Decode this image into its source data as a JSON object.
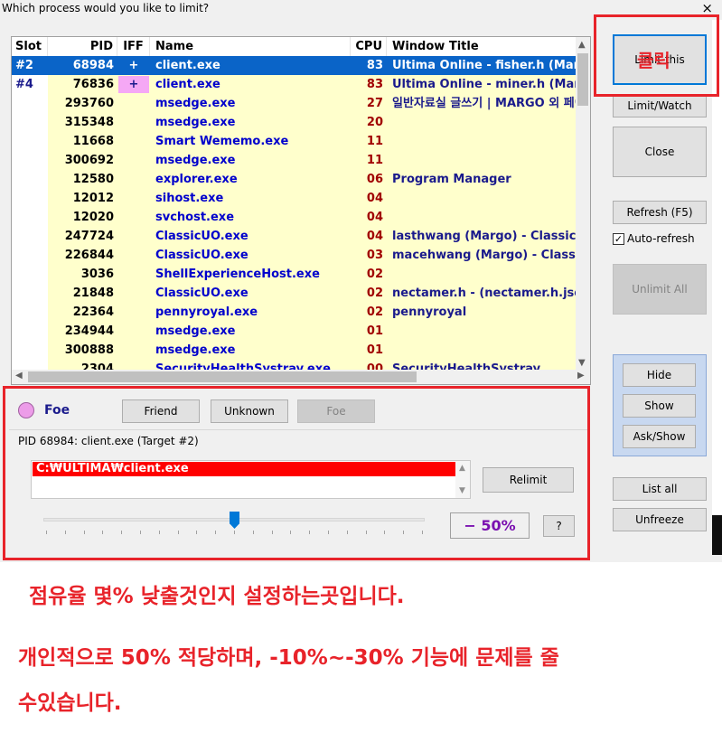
{
  "window": {
    "title": "Which process would you like to limit?",
    "close_glyph": "×"
  },
  "table": {
    "headers": {
      "slot": "Slot",
      "pid": "PID",
      "iff": "IFF",
      "name": "Name",
      "cpu": "CPU",
      "window_title": "Window Title"
    },
    "rows": [
      {
        "slot": "#2",
        "pid": "68984",
        "iff": "+",
        "name": "client.exe",
        "cpu": "83",
        "window_title": "Ultima Online - fisher.h (Margo)",
        "selected": true
      },
      {
        "slot": "#4",
        "pid": "76836",
        "iff": "+",
        "name": "client.exe",
        "cpu": "83",
        "window_title": "Ultima Online - miner.h (Margo)",
        "iff_pink": true
      },
      {
        "slot": "",
        "pid": "293760",
        "iff": "",
        "name": "msedge.exe",
        "cpu": "27",
        "window_title": "일반자료실 글쓰기 | MARGO 외 페이"
      },
      {
        "slot": "",
        "pid": "315348",
        "iff": "",
        "name": "msedge.exe",
        "cpu": "20",
        "window_title": ""
      },
      {
        "slot": "",
        "pid": "11668",
        "iff": "",
        "name": "Smart Wememo.exe",
        "cpu": "11",
        "window_title": ""
      },
      {
        "slot": "",
        "pid": "300692",
        "iff": "",
        "name": "msedge.exe",
        "cpu": "11",
        "window_title": ""
      },
      {
        "slot": "",
        "pid": "12580",
        "iff": "",
        "name": "explorer.exe",
        "cpu": "06",
        "window_title": "Program Manager"
      },
      {
        "slot": "",
        "pid": "12012",
        "iff": "",
        "name": "sihost.exe",
        "cpu": "04",
        "window_title": ""
      },
      {
        "slot": "",
        "pid": "12020",
        "iff": "",
        "name": "svchost.exe",
        "cpu": "04",
        "window_title": ""
      },
      {
        "slot": "",
        "pid": "247724",
        "iff": "",
        "name": "ClassicUO.exe",
        "cpu": "04",
        "window_title": "lasthwang (Margo) - ClassicUO"
      },
      {
        "slot": "",
        "pid": "226844",
        "iff": "",
        "name": "ClassicUO.exe",
        "cpu": "03",
        "window_title": "macehwang (Margo) - ClassicUO"
      },
      {
        "slot": "",
        "pid": "3036",
        "iff": "",
        "name": "ShellExperienceHost.exe",
        "cpu": "02",
        "window_title": ""
      },
      {
        "slot": "",
        "pid": "21848",
        "iff": "",
        "name": "ClassicUO.exe",
        "cpu": "02",
        "window_title": "nectamer.h - (nectamer.h.json)"
      },
      {
        "slot": "",
        "pid": "22364",
        "iff": "",
        "name": "pennyroyal.exe",
        "cpu": "02",
        "window_title": "pennyroyal"
      },
      {
        "slot": "",
        "pid": "234944",
        "iff": "",
        "name": "msedge.exe",
        "cpu": "01",
        "window_title": ""
      },
      {
        "slot": "",
        "pid": "300888",
        "iff": "",
        "name": "msedge.exe",
        "cpu": "01",
        "window_title": ""
      },
      {
        "slot": "",
        "pid": "2304",
        "iff": "",
        "name": "SecurityHealthSystray.exe",
        "cpu": "00",
        "window_title": "SecurityHealthSystray"
      }
    ]
  },
  "sidebar": {
    "limit_this": "Limit this",
    "limit_watch": "Limit/Watch",
    "close": "Close",
    "refresh": "Refresh (F5)",
    "auto_refresh": "Auto-refresh",
    "auto_refresh_checked": true,
    "unlimit_all": "Unlimit All",
    "hide": "Hide",
    "show": "Show",
    "ask_show": "Ask/Show",
    "list_all": "List all",
    "unfreeze": "Unfreeze"
  },
  "details": {
    "iff_status": "Foe",
    "friend": "Friend",
    "unknown": "Unknown",
    "foe": "Foe",
    "pid_label": "PID 68984: client.exe (Target #2)",
    "path": "C:₩ULTIMA₩client.exe",
    "relimit": "Relimit",
    "limit_percent": "− 50%",
    "slider_fraction": 0.5,
    "help": "?"
  },
  "annotations": {
    "click_label": "클릭",
    "line1": "점유율 몇% 낮출것인지 설정하는곳입니다.",
    "line2": "개인적으로 50% 적당하며, -10%~-30% 기능에 문제를 줄",
    "line3": "수있습니다."
  },
  "colors": {
    "annotation_red": "#e8232a",
    "selection_blue": "#0a64c8",
    "row_yellow": "#ffffcc",
    "foe_pink": "#ec9ce8",
    "path_red": "#ff0000",
    "percent_purple": "#7a10b0"
  }
}
